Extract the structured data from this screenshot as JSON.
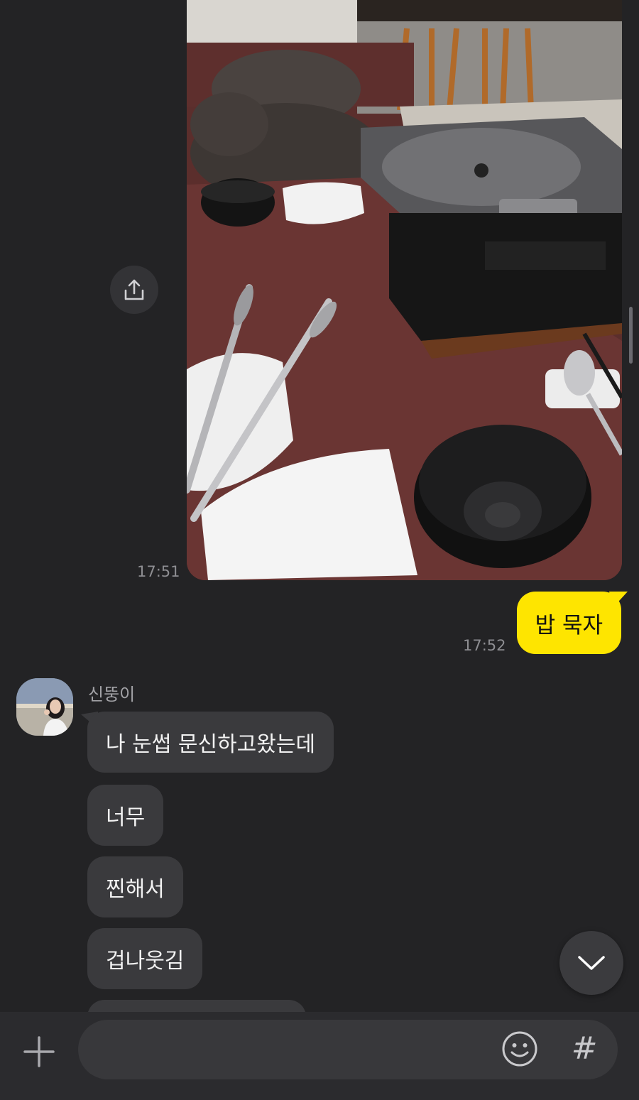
{
  "messages": {
    "photo": {
      "time": "17:51",
      "alt": "shared photo of restaurant table with grill"
    },
    "mine": {
      "text": "밥 묵자",
      "time": "17:52"
    },
    "friend": {
      "name": "신뚱이",
      "bubbles": [
        "나 눈썹 문신하고왔는데",
        "너무",
        "찐해서",
        "겁나웃김"
      ]
    }
  },
  "composer": {
    "value": "",
    "placeholder": ""
  },
  "icons": {
    "share": "share-icon",
    "scroll_down": "chevron-down-icon",
    "plus": "plus-icon",
    "emoji": "emoji-icon",
    "hash": "hash-icon"
  },
  "colors": {
    "background": "#232325",
    "my_bubble": "#fee500",
    "their_bubble": "#3a3a3d"
  }
}
